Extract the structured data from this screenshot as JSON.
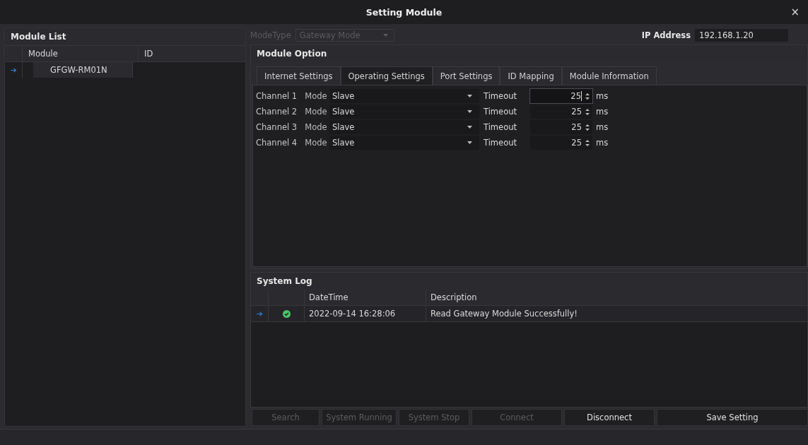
{
  "window": {
    "title": "Setting Module",
    "close": "×"
  },
  "module_list": {
    "title": "Module List",
    "columns": [
      "Module",
      "ID"
    ],
    "rows": [
      {
        "module": "GFGW-RM01N",
        "id": "",
        "selected": true
      }
    ]
  },
  "mode_type": {
    "label": "ModeType",
    "value": "Gateway Mode",
    "disabled": true
  },
  "ip_address": {
    "label": "IP Address",
    "value": "192.168.1.20"
  },
  "module_option": {
    "title": "Module Option",
    "tabs": [
      {
        "label": "Internet Settings",
        "selected": false
      },
      {
        "label": "Operating Settings",
        "selected": true
      },
      {
        "label": "Port Settings",
        "selected": false
      },
      {
        "label": "ID Mapping",
        "selected": false
      },
      {
        "label": "Module Information",
        "selected": false
      }
    ],
    "channels": [
      {
        "name": "Channel 1",
        "mode_label": "Mode",
        "mode": "Slave",
        "timeout_label": "Timeout",
        "timeout": "25",
        "unit": "ms",
        "focused": true
      },
      {
        "name": "Channel 2",
        "mode_label": "Mode",
        "mode": "Slave",
        "timeout_label": "Timeout",
        "timeout": "25",
        "unit": "ms",
        "focused": false
      },
      {
        "name": "Channel 3",
        "mode_label": "Mode",
        "mode": "Slave",
        "timeout_label": "Timeout",
        "timeout": "25",
        "unit": "ms",
        "focused": false
      },
      {
        "name": "Channel 4",
        "mode_label": "Mode",
        "mode": "Slave",
        "timeout_label": "Timeout",
        "timeout": "25",
        "unit": "ms",
        "focused": false
      }
    ]
  },
  "system_log": {
    "title": "System Log",
    "columns": [
      "DateTime",
      "Description"
    ],
    "rows": [
      {
        "kind": "success",
        "datetime": "2022-09-14 16:28:06",
        "description": "Read Gateway Module Successfully!",
        "selected": true
      }
    ]
  },
  "buttons": [
    {
      "label": "Search",
      "disabled": true
    },
    {
      "label": "System Running",
      "disabled": true
    },
    {
      "label": "System Stop",
      "disabled": true
    },
    {
      "label": "Connect",
      "disabled": true
    },
    {
      "label": "Disconnect",
      "disabled": false
    },
    {
      "label": "Save Setting",
      "disabled": false
    }
  ]
}
